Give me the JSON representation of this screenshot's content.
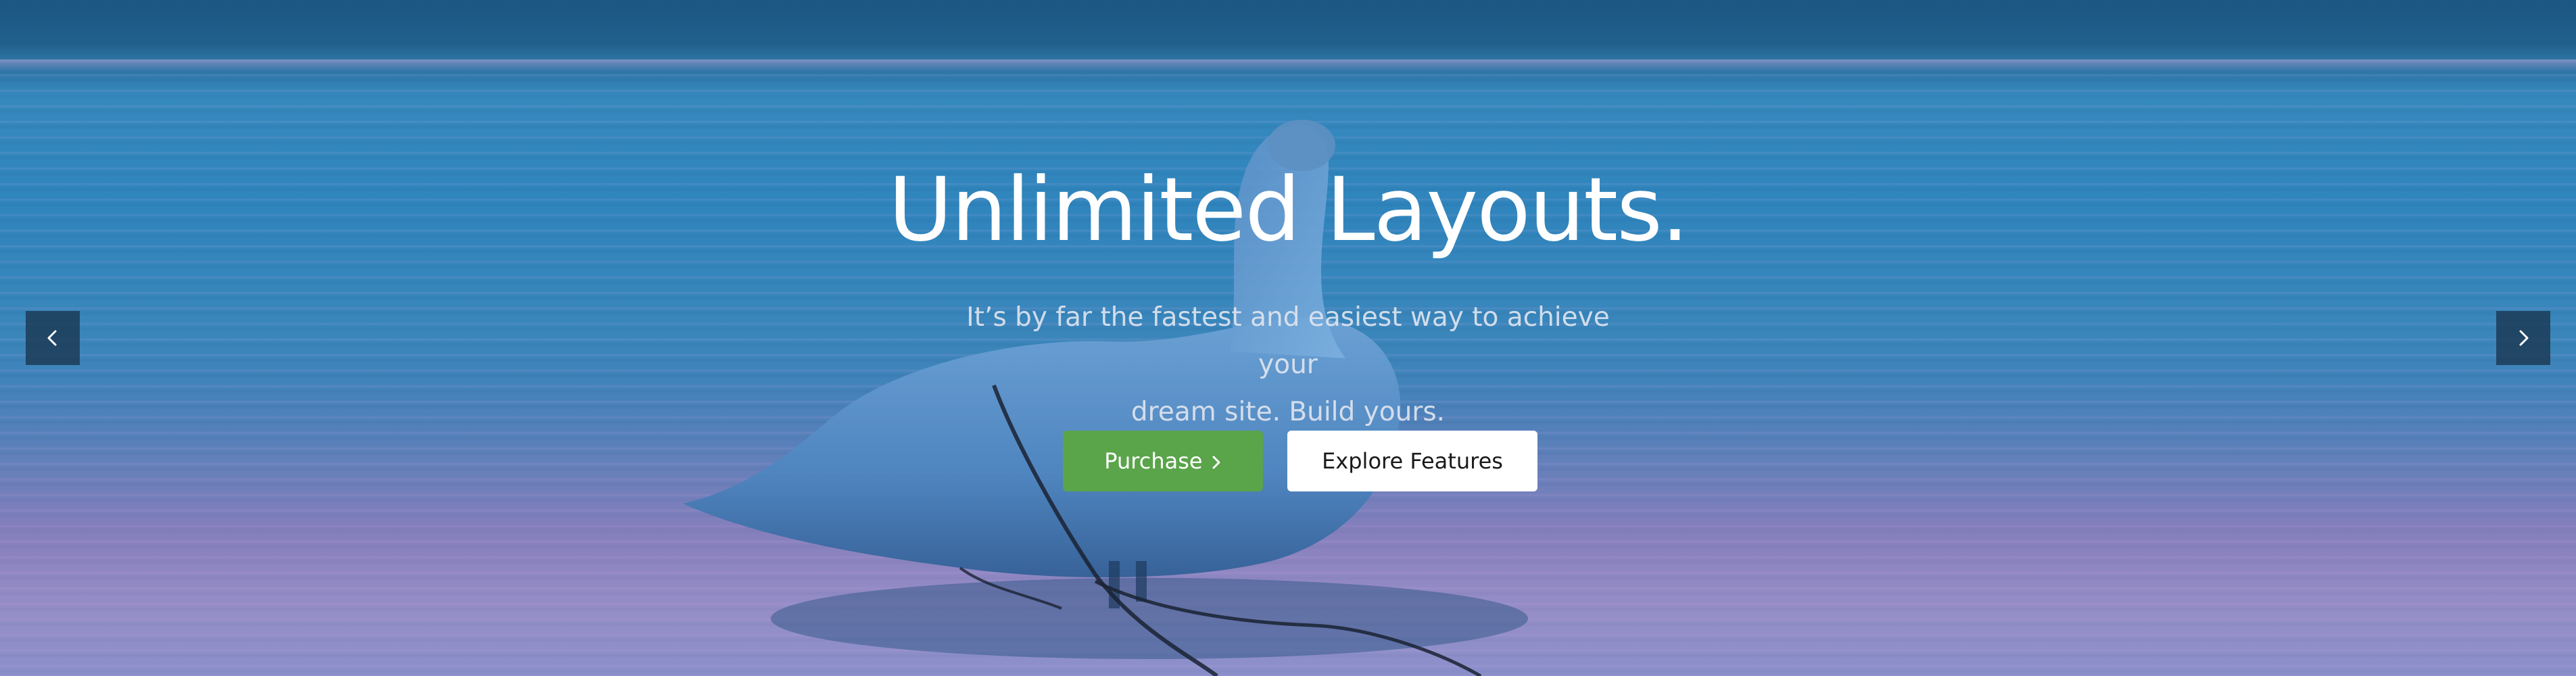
{
  "hero": {
    "headline": "Unlimited Layouts.",
    "subtitle_line1": "It’s by far the fastest and easiest way to achieve your",
    "subtitle_line2": "dream site. Build yours.",
    "purchase_label": "Purchase",
    "purchase_icon": "chevron-right-icon",
    "explore_label": "Explore Features"
  },
  "slider": {
    "prev_icon": "chevron-left-icon",
    "next_icon": "chevron-right-icon"
  },
  "colors": {
    "purchase_bg": "#5aa44a",
    "explore_bg": "#ffffff",
    "overlay_tint": "#2f85bd",
    "arrow_bg": "#1a344e"
  }
}
